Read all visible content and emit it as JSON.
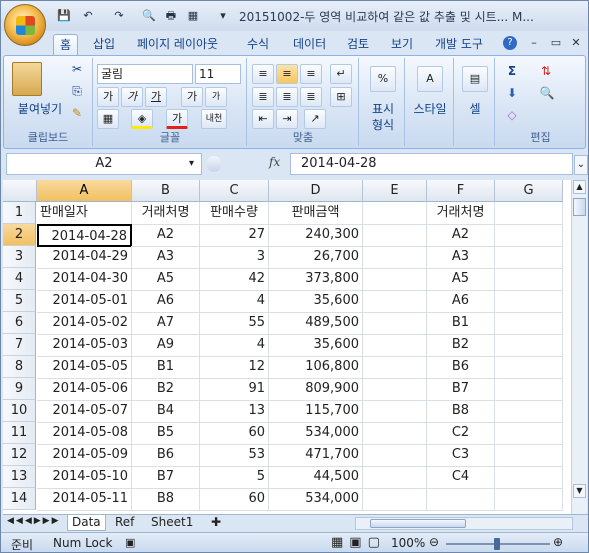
{
  "title": "20151002-두 영역 비교하여 같은 값 추출 및 시트... M...",
  "tabs": [
    "홈",
    "삽입",
    "페이지 레이아웃",
    "수식",
    "데이터",
    "검토",
    "보기",
    "개발 도구"
  ],
  "ribbon": {
    "clipboard": {
      "paste": "붙여넣기",
      "label": "클립보드"
    },
    "font": {
      "name": "굴림",
      "size": "11",
      "label": "글꼴",
      "grow": "가",
      "shrink": "가",
      "bold": "가",
      "italic": "가",
      "underline": "가",
      "strike": "가",
      "phonetic": "내천"
    },
    "align": {
      "label": "맞춤"
    },
    "number": {
      "btn1": "표시",
      "btn2": "형식",
      "pct": "%"
    },
    "style": {
      "btn": "스타일"
    },
    "cells": {
      "btn": "셀"
    },
    "edit": {
      "label": "편집",
      "sigma": "Σ",
      "sort": "정렬"
    }
  },
  "formula": {
    "namebox": "A2",
    "fx": "fx",
    "value": "2014-04-28"
  },
  "columns": [
    "A",
    "B",
    "C",
    "D",
    "E",
    "F",
    "G"
  ],
  "rows": [
    [
      "판매일자",
      "거래처명",
      "판매수량",
      "판매금액",
      "",
      "거래처명",
      ""
    ],
    [
      "2014-04-28",
      "A2",
      "27",
      "240,300",
      "",
      "A2",
      ""
    ],
    [
      "2014-04-29",
      "A3",
      "3",
      "26,700",
      "",
      "A3",
      ""
    ],
    [
      "2014-04-30",
      "A5",
      "42",
      "373,800",
      "",
      "A5",
      ""
    ],
    [
      "2014-05-01",
      "A6",
      "4",
      "35,600",
      "",
      "A6",
      ""
    ],
    [
      "2014-05-02",
      "A7",
      "55",
      "489,500",
      "",
      "B1",
      ""
    ],
    [
      "2014-05-03",
      "A9",
      "4",
      "35,600",
      "",
      "B2",
      ""
    ],
    [
      "2014-05-05",
      "B1",
      "12",
      "106,800",
      "",
      "B6",
      ""
    ],
    [
      "2014-05-06",
      "B2",
      "91",
      "809,900",
      "",
      "B7",
      ""
    ],
    [
      "2014-05-07",
      "B4",
      "13",
      "115,700",
      "",
      "B8",
      ""
    ],
    [
      "2014-05-08",
      "B5",
      "60",
      "534,000",
      "",
      "C2",
      ""
    ],
    [
      "2014-05-09",
      "B6",
      "53",
      "471,700",
      "",
      "C3",
      ""
    ],
    [
      "2014-05-10",
      "B7",
      "5",
      "44,500",
      "",
      "C4",
      ""
    ],
    [
      "2014-05-11",
      "B8",
      "60",
      "534,000",
      "",
      "",
      " "
    ]
  ],
  "sheets": [
    "Data",
    "Ref",
    "Sheet1"
  ],
  "status": {
    "ready": "준비",
    "numlock": "Num Lock",
    "zoom": "100%"
  }
}
